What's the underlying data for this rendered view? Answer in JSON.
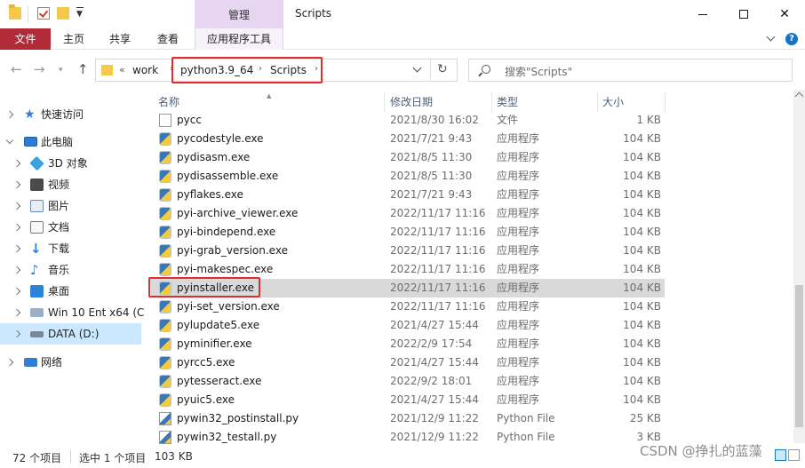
{
  "titlebar": {
    "manage_label": "管理",
    "window_title": "Scripts"
  },
  "ribbon": {
    "tabs": [
      "文件",
      "主页",
      "共享",
      "查看",
      "应用程序工具"
    ]
  },
  "address": {
    "crumbs": [
      "work",
      "python3.9_64",
      "Scripts"
    ]
  },
  "search": {
    "placeholder": "搜索\"Scripts\""
  },
  "columns": [
    "名称",
    "修改日期",
    "类型",
    "大小"
  ],
  "sidebar": {
    "items": [
      {
        "label": "快速访问",
        "icon": "quick-access-star-icon",
        "level": 0,
        "expanded": false
      },
      {
        "label": "此电脑",
        "icon": "this-pc-icon",
        "level": 0,
        "expanded": true
      },
      {
        "label": "3D 对象",
        "icon": "3d-objects-icon",
        "level": 1,
        "expanded": false
      },
      {
        "label": "视频",
        "icon": "videos-icon",
        "level": 1,
        "expanded": false
      },
      {
        "label": "图片",
        "icon": "pictures-icon",
        "level": 1,
        "expanded": false
      },
      {
        "label": "文档",
        "icon": "documents-icon",
        "level": 1,
        "expanded": false
      },
      {
        "label": "下载",
        "icon": "downloads-icon",
        "level": 1,
        "expanded": false
      },
      {
        "label": "音乐",
        "icon": "music-icon",
        "level": 1,
        "expanded": false
      },
      {
        "label": "桌面",
        "icon": "desktop-icon",
        "level": 1,
        "expanded": false
      },
      {
        "label": "Win 10 Ent x64 (C",
        "icon": "system-drive-icon",
        "level": 1,
        "expanded": false
      },
      {
        "label": "DATA (D:)",
        "icon": "drive-icon",
        "level": 1,
        "expanded": false,
        "selected": true
      },
      {
        "label": "网络",
        "icon": "network-icon",
        "level": 0,
        "expanded": false
      }
    ]
  },
  "files": [
    {
      "name": "pycc",
      "date": "2021/8/30 16:02",
      "type": "文件",
      "size": "1 KB",
      "icon": "blank"
    },
    {
      "name": "pycodestyle.exe",
      "date": "2021/7/21 9:43",
      "type": "应用程序",
      "size": "104 KB",
      "icon": "exe"
    },
    {
      "name": "pydisasm.exe",
      "date": "2021/8/5 11:30",
      "type": "应用程序",
      "size": "104 KB",
      "icon": "exe"
    },
    {
      "name": "pydisassemble.exe",
      "date": "2021/8/5 11:30",
      "type": "应用程序",
      "size": "104 KB",
      "icon": "exe"
    },
    {
      "name": "pyflakes.exe",
      "date": "2021/7/21 9:43",
      "type": "应用程序",
      "size": "104 KB",
      "icon": "exe"
    },
    {
      "name": "pyi-archive_viewer.exe",
      "date": "2022/11/17 11:16",
      "type": "应用程序",
      "size": "104 KB",
      "icon": "exe"
    },
    {
      "name": "pyi-bindepend.exe",
      "date": "2022/11/17 11:16",
      "type": "应用程序",
      "size": "104 KB",
      "icon": "exe"
    },
    {
      "name": "pyi-grab_version.exe",
      "date": "2022/11/17 11:16",
      "type": "应用程序",
      "size": "104 KB",
      "icon": "exe"
    },
    {
      "name": "pyi-makespec.exe",
      "date": "2022/11/17 11:16",
      "type": "应用程序",
      "size": "104 KB",
      "icon": "exe"
    },
    {
      "name": "pyinstaller.exe",
      "date": "2022/11/17 11:16",
      "type": "应用程序",
      "size": "104 KB",
      "icon": "exe",
      "selected": true
    },
    {
      "name": "pyi-set_version.exe",
      "date": "2022/11/17 11:16",
      "type": "应用程序",
      "size": "104 KB",
      "icon": "exe"
    },
    {
      "name": "pylupdate5.exe",
      "date": "2021/4/27 15:44",
      "type": "应用程序",
      "size": "104 KB",
      "icon": "exe"
    },
    {
      "name": "pyminifier.exe",
      "date": "2022/2/9 17:54",
      "type": "应用程序",
      "size": "104 KB",
      "icon": "exe"
    },
    {
      "name": "pyrcc5.exe",
      "date": "2021/4/27 15:44",
      "type": "应用程序",
      "size": "104 KB",
      "icon": "exe"
    },
    {
      "name": "pytesseract.exe",
      "date": "2022/9/2 18:01",
      "type": "应用程序",
      "size": "104 KB",
      "icon": "exe"
    },
    {
      "name": "pyuic5.exe",
      "date": "2021/4/27 15:44",
      "type": "应用程序",
      "size": "104 KB",
      "icon": "exe"
    },
    {
      "name": "pywin32_postinstall.py",
      "date": "2021/12/9 11:22",
      "type": "Python File",
      "size": "25 KB",
      "icon": "py"
    },
    {
      "name": "pywin32_testall.py",
      "date": "2021/12/9 11:22",
      "type": "Python File",
      "size": "3 KB",
      "icon": "py"
    }
  ],
  "status": {
    "count": "72 个项目",
    "selection": "选中 1 个项目",
    "selection_size": "103 KB"
  },
  "watermark": "CSDN @挣扎的蓝藻",
  "colors": {
    "file_tab": "#b02a37",
    "manage_tab": "#e6d6f2",
    "selection": "#cce8ff",
    "highlight_box": "#e62b2b"
  }
}
